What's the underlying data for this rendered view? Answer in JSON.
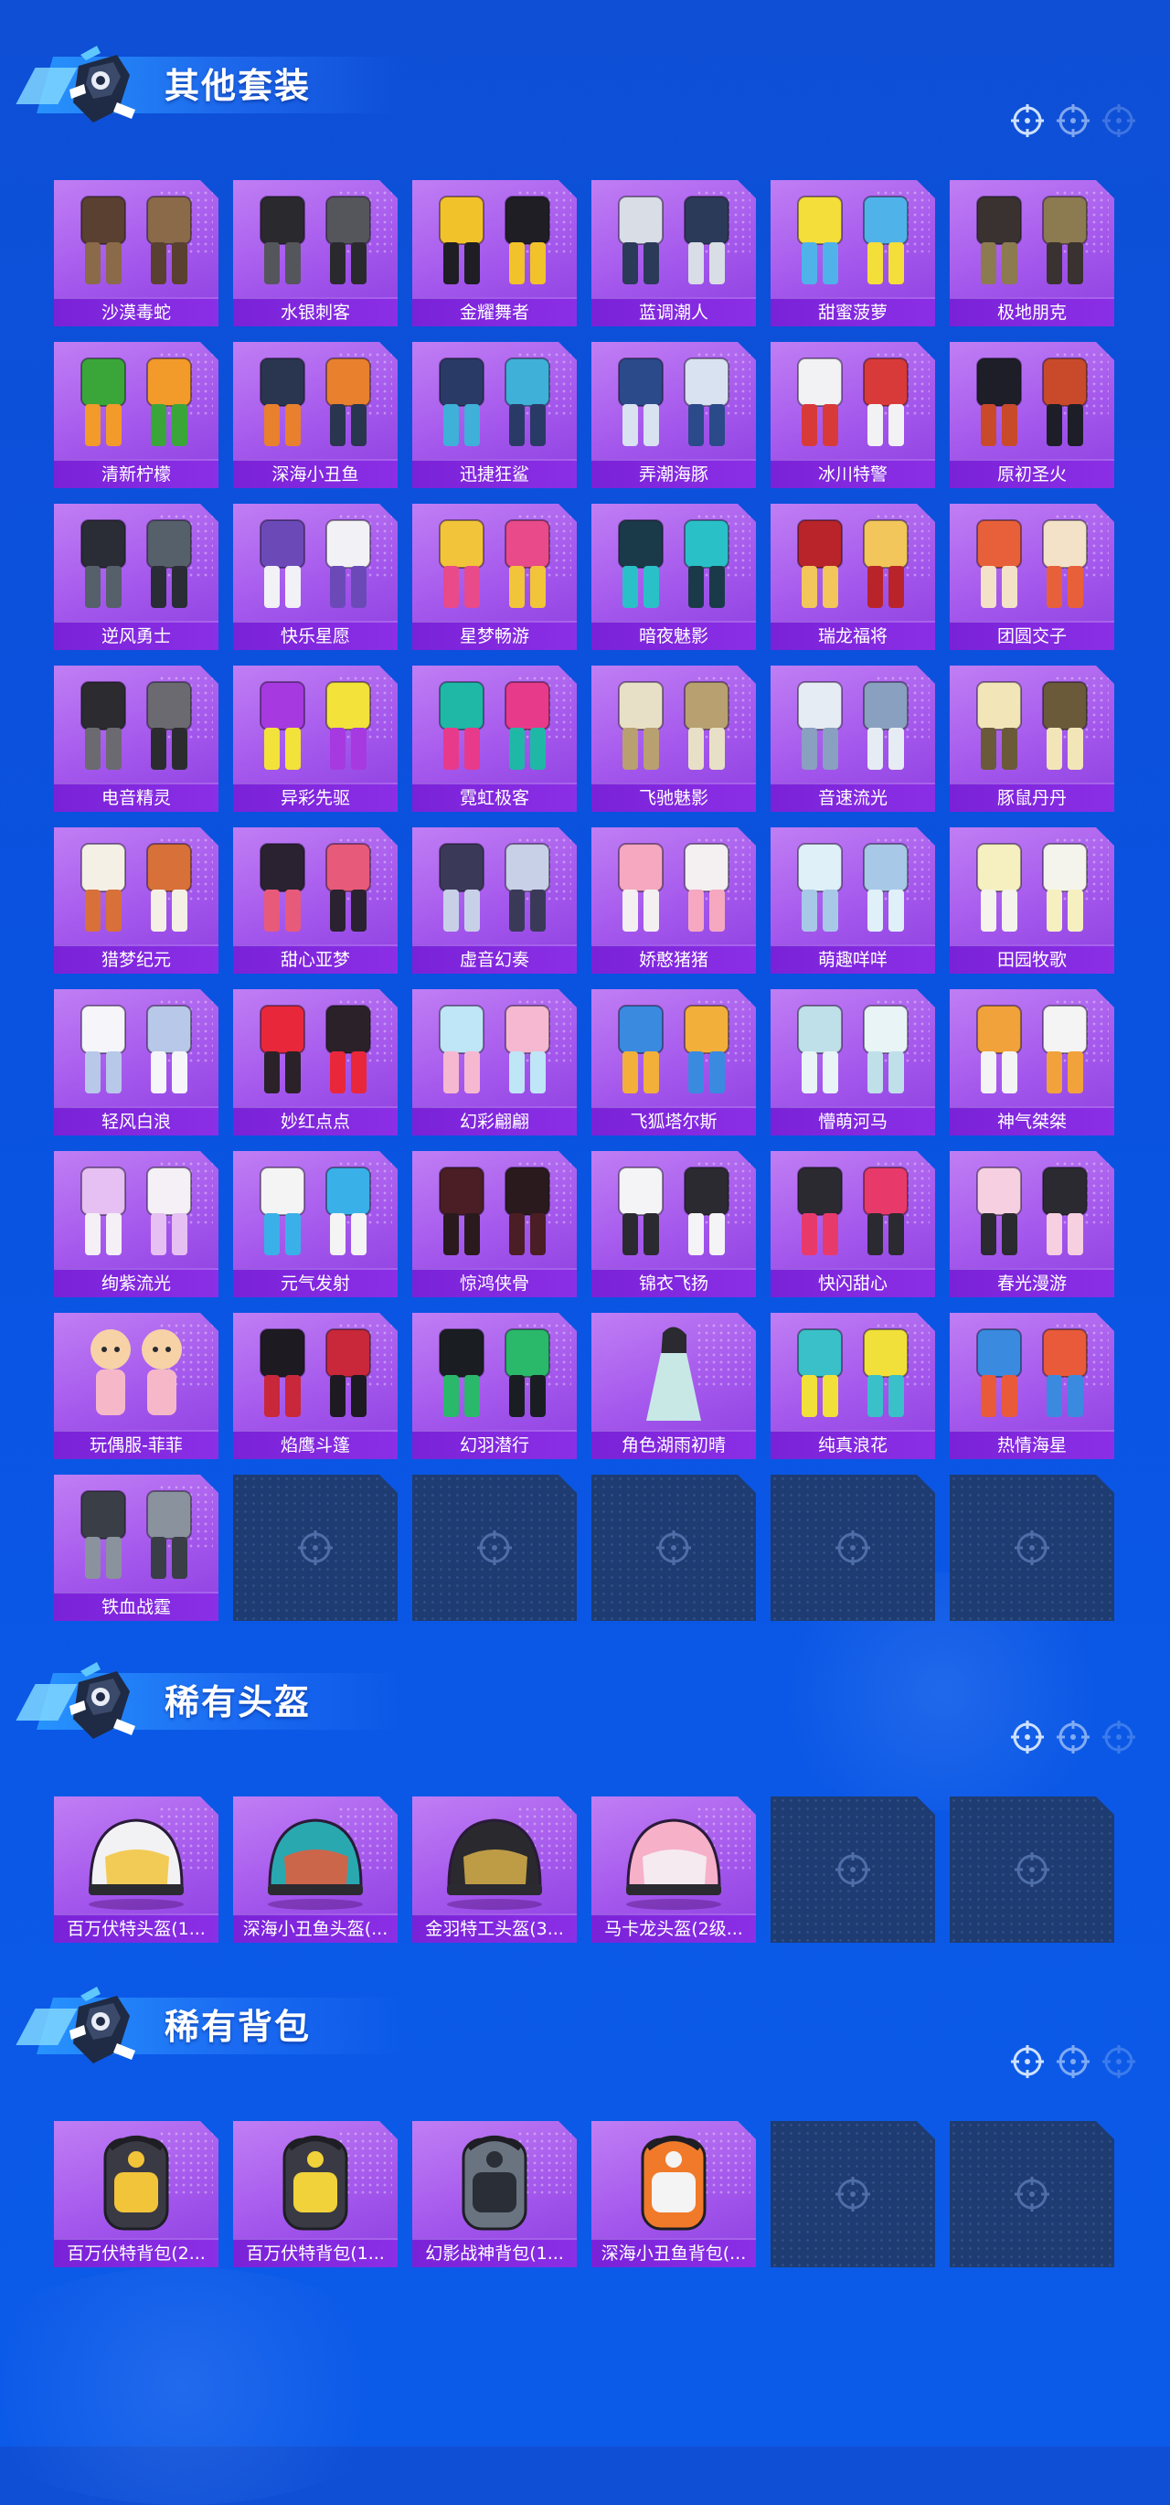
{
  "colors": {
    "background": "#0b53e2",
    "card_purple": "#a457ec",
    "label_purple": "#7a22d8",
    "empty_slot": "#1e3c72",
    "title_text": "#ffffff"
  },
  "sections": [
    {
      "title": "其他套装",
      "icon": "crosshair-icon",
      "items": [
        {
          "name": "沙漠毒蛇",
          "art": "outfit",
          "c1": "#5a4030",
          "c2": "#8a6a48"
        },
        {
          "name": "水银刺客",
          "art": "outfit",
          "c1": "#2a2a2e",
          "c2": "#55565c"
        },
        {
          "name": "金耀舞者",
          "art": "outfit",
          "c1": "#f2c22a",
          "c2": "#1e1e24"
        },
        {
          "name": "蓝调潮人",
          "art": "outfit",
          "c1": "#d8dde6",
          "c2": "#2b3a58"
        },
        {
          "name": "甜蜜菠萝",
          "art": "outfit",
          "c1": "#f4de3a",
          "c2": "#4fb3ea"
        },
        {
          "name": "极地朋克",
          "art": "outfit",
          "c1": "#3a3230",
          "c2": "#8c7a50"
        },
        {
          "name": "清新柠檬",
          "art": "outfit",
          "c1": "#3aa63a",
          "c2": "#f29a2a"
        },
        {
          "name": "深海小丑鱼",
          "art": "outfit",
          "c1": "#2a3550",
          "c2": "#e8802e"
        },
        {
          "name": "迅捷狂鲨",
          "art": "outfit",
          "c1": "#2a3a66",
          "c2": "#3fb0d8"
        },
        {
          "name": "弄潮海豚",
          "art": "outfit",
          "c1": "#2b4a8a",
          "c2": "#d8e2f0"
        },
        {
          "name": "冰川特警",
          "art": "outfit",
          "c1": "#f2f2f4",
          "c2": "#d83a3a"
        },
        {
          "name": "原初圣火",
          "art": "outfit",
          "c1": "#1e1e28",
          "c2": "#c84a2a"
        },
        {
          "name": "逆风勇士",
          "art": "outfit",
          "c1": "#2a2c36",
          "c2": "#55606a"
        },
        {
          "name": "快乐星愿",
          "art": "outfit",
          "c1": "#6b4ab8",
          "c2": "#f2f2f6"
        },
        {
          "name": "星梦畅游",
          "art": "outfit",
          "c1": "#f2c43a",
          "c2": "#e84a8a"
        },
        {
          "name": "暗夜魅影",
          "art": "outfit",
          "c1": "#1a3a4a",
          "c2": "#2ac0c8"
        },
        {
          "name": "瑞龙福将",
          "art": "outfit",
          "c1": "#b8242a",
          "c2": "#f2c65a"
        },
        {
          "name": "团圆交子",
          "art": "outfit",
          "c1": "#e8603a",
          "c2": "#f4e2c8"
        },
        {
          "name": "电音精灵",
          "art": "outfit",
          "c1": "#2c2c30",
          "c2": "#6a6a70"
        },
        {
          "name": "异彩先驱",
          "art": "outfit",
          "c1": "#a63ae0",
          "c2": "#f2e23a"
        },
        {
          "name": "霓虹极客",
          "art": "outfit",
          "c1": "#1fb8a6",
          "c2": "#e83a8a"
        },
        {
          "name": "飞驰魅影",
          "art": "outfit",
          "c1": "#e8e0c6",
          "c2": "#b8a070"
        },
        {
          "name": "音速流光",
          "art": "outfit",
          "c1": "#e6ecf4",
          "c2": "#8aa0c0"
        },
        {
          "name": "豚鼠丹丹",
          "art": "outfit",
          "c1": "#f2e6b8",
          "c2": "#6a5a3a"
        },
        {
          "name": "猎梦纪元",
          "art": "outfit",
          "c1": "#f4f0e6",
          "c2": "#d8703a"
        },
        {
          "name": "甜心亚梦",
          "art": "outfit",
          "c1": "#2a2230",
          "c2": "#e85a7a"
        },
        {
          "name": "虚音幻奏",
          "art": "outfit",
          "c1": "#3a3a58",
          "c2": "#c8d0e8"
        },
        {
          "name": "娇憨猪猪",
          "art": "outfit",
          "c1": "#f6a8c0",
          "c2": "#f4f0f2"
        },
        {
          "name": "萌趣咩咩",
          "art": "outfit",
          "c1": "#dff0f8",
          "c2": "#a8c8e8"
        },
        {
          "name": "田园牧歌",
          "art": "outfit",
          "c1": "#f6f0c0",
          "c2": "#f4f4ec"
        },
        {
          "name": "轻风白浪",
          "art": "outfit",
          "c1": "#f6f6fa",
          "c2": "#b8c8e8"
        },
        {
          "name": "妙红点点",
          "art": "outfit",
          "c1": "#e8283a",
          "c2": "#2a2228"
        },
        {
          "name": "幻彩翩翩",
          "art": "outfit",
          "c1": "#bfe6f6",
          "c2": "#f6b8d0"
        },
        {
          "name": "飞狐塔尔斯",
          "art": "outfit",
          "c1": "#3a8ae0",
          "c2": "#f2b03a"
        },
        {
          "name": "懵萌河马",
          "art": "outfit",
          "c1": "#bfe0e8",
          "c2": "#e8f4f6"
        },
        {
          "name": "神气桀桀",
          "art": "outfit",
          "c1": "#f2a23a",
          "c2": "#f4f4f4"
        },
        {
          "name": "绚紫流光",
          "art": "outfit",
          "c1": "#e6c0f2",
          "c2": "#f4f0f6"
        },
        {
          "name": "元气发射",
          "art": "outfit",
          "c1": "#f4f4f4",
          "c2": "#3ab0e8"
        },
        {
          "name": "惊鸿侠骨",
          "art": "outfit",
          "c1": "#4a1e24",
          "c2": "#2a1a1e"
        },
        {
          "name": "锦衣飞扬",
          "art": "outfit",
          "c1": "#f4f4f6",
          "c2": "#2a2a30"
        },
        {
          "name": "快闪甜心",
          "art": "outfit",
          "c1": "#2a2a30",
          "c2": "#e83a6a"
        },
        {
          "name": "春光漫游",
          "art": "outfit",
          "c1": "#f6d0e0",
          "c2": "#2a2a30"
        },
        {
          "name": "玩偶服-菲菲",
          "art": "doll",
          "c1": "#f6d2a6",
          "c2": "#f6b8c8"
        },
        {
          "name": "焰鹰斗篷",
          "art": "outfit",
          "c1": "#1e1a22",
          "c2": "#c8283a"
        },
        {
          "name": "幻羽潜行",
          "art": "outfit",
          "c1": "#1a1e22",
          "c2": "#2ab86a"
        },
        {
          "name": "角色湖雨初晴",
          "art": "character",
          "c1": "#c8e8e6",
          "c2": "#2a2a30"
        },
        {
          "name": "纯真浪花",
          "art": "outfit",
          "c1": "#3ac0c8",
          "c2": "#f2e03a"
        },
        {
          "name": "热情海星",
          "art": "outfit",
          "c1": "#3a8ae0",
          "c2": "#e85a3a"
        },
        {
          "name": "铁血战霆",
          "art": "outfit",
          "c1": "#3a3e46",
          "c2": "#8a929e"
        },
        {
          "name": "",
          "empty": true
        },
        {
          "name": "",
          "empty": true
        },
        {
          "name": "",
          "empty": true
        },
        {
          "name": "",
          "empty": true
        },
        {
          "name": "",
          "empty": true
        }
      ]
    },
    {
      "title": "稀有头盔",
      "icon": "crosshair-icon",
      "items": [
        {
          "name": "百万伏特头盔(1...",
          "art": "helmet",
          "c1": "#f2f2f4",
          "c2": "#f2c43a"
        },
        {
          "name": "深海小丑鱼头盔(...",
          "art": "helmet",
          "c1": "#2aa8b0",
          "c2": "#e85a3a"
        },
        {
          "name": "金羽特工头盔(3...",
          "art": "helmet",
          "c1": "#2a2a2e",
          "c2": "#d8b04a"
        },
        {
          "name": "马卡龙头盔(2级...",
          "art": "helmet",
          "c1": "#f6b0c8",
          "c2": "#f4f4f6"
        },
        {
          "name": "",
          "empty": true
        },
        {
          "name": "",
          "empty": true
        }
      ]
    },
    {
      "title": "稀有背包",
      "icon": "crosshair-icon",
      "items": [
        {
          "name": "百万伏特背包(2...",
          "art": "backpack",
          "c1": "#3a3a44",
          "c2": "#f2c43a"
        },
        {
          "name": "百万伏特背包(1...",
          "art": "backpack",
          "c1": "#3a3a44",
          "c2": "#f2d23a"
        },
        {
          "name": "幻影战神背包(1...",
          "art": "backpack",
          "c1": "#6a7480",
          "c2": "#2a2e36"
        },
        {
          "name": "深海小丑鱼背包(...",
          "art": "backpack",
          "c1": "#f07a2a",
          "c2": "#f4f4f4"
        },
        {
          "name": "",
          "empty": true
        },
        {
          "name": "",
          "empty": true
        }
      ]
    }
  ]
}
